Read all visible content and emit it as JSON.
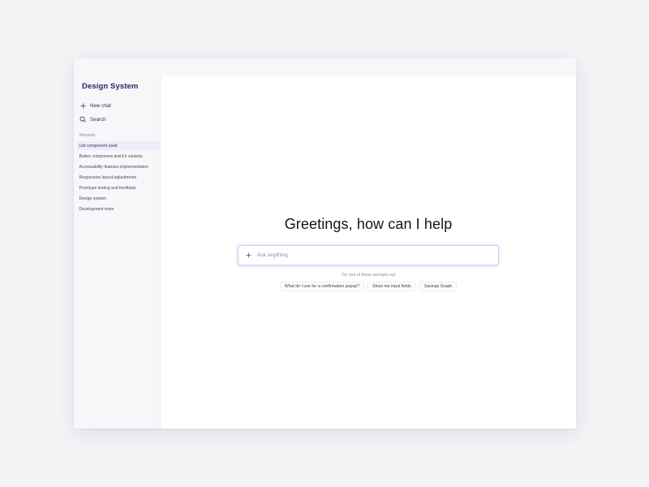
{
  "sidebar": {
    "brand": "Design System",
    "new_chat_label": "New chat",
    "new_chat_icon": "plus-icon",
    "search_label": "Search",
    "search_icon": "search-icon",
    "recents_label": "Recents",
    "recents": [
      {
        "label": "List component used",
        "active": true
      },
      {
        "label": "Button component and it's variants",
        "active": false
      },
      {
        "label": "Accessability features implementation",
        "active": false
      },
      {
        "label": "Responsive layout adjustments",
        "active": false
      },
      {
        "label": "Prototype testing and feedback",
        "active": false
      },
      {
        "label": "Design system",
        "active": false
      },
      {
        "label": "Development team",
        "active": false
      }
    ]
  },
  "main": {
    "greeting": "Greetings, how can I help",
    "input": {
      "placeholder": "Ask anything",
      "value": "",
      "attach_icon": "plus-icon"
    },
    "prompt_hint": "Try one of these prompts out",
    "prompts": [
      "What do I use for a confirmation popup?",
      "Show me input fields",
      "Savings Graph"
    ]
  },
  "colors": {
    "brand_text": "#2b2569",
    "active_recent_bg": "#eeecf8",
    "input_border": "#cfcaf3",
    "sidebar_bg": "#f7f6f9",
    "backdrop": "#f4f3f6"
  }
}
